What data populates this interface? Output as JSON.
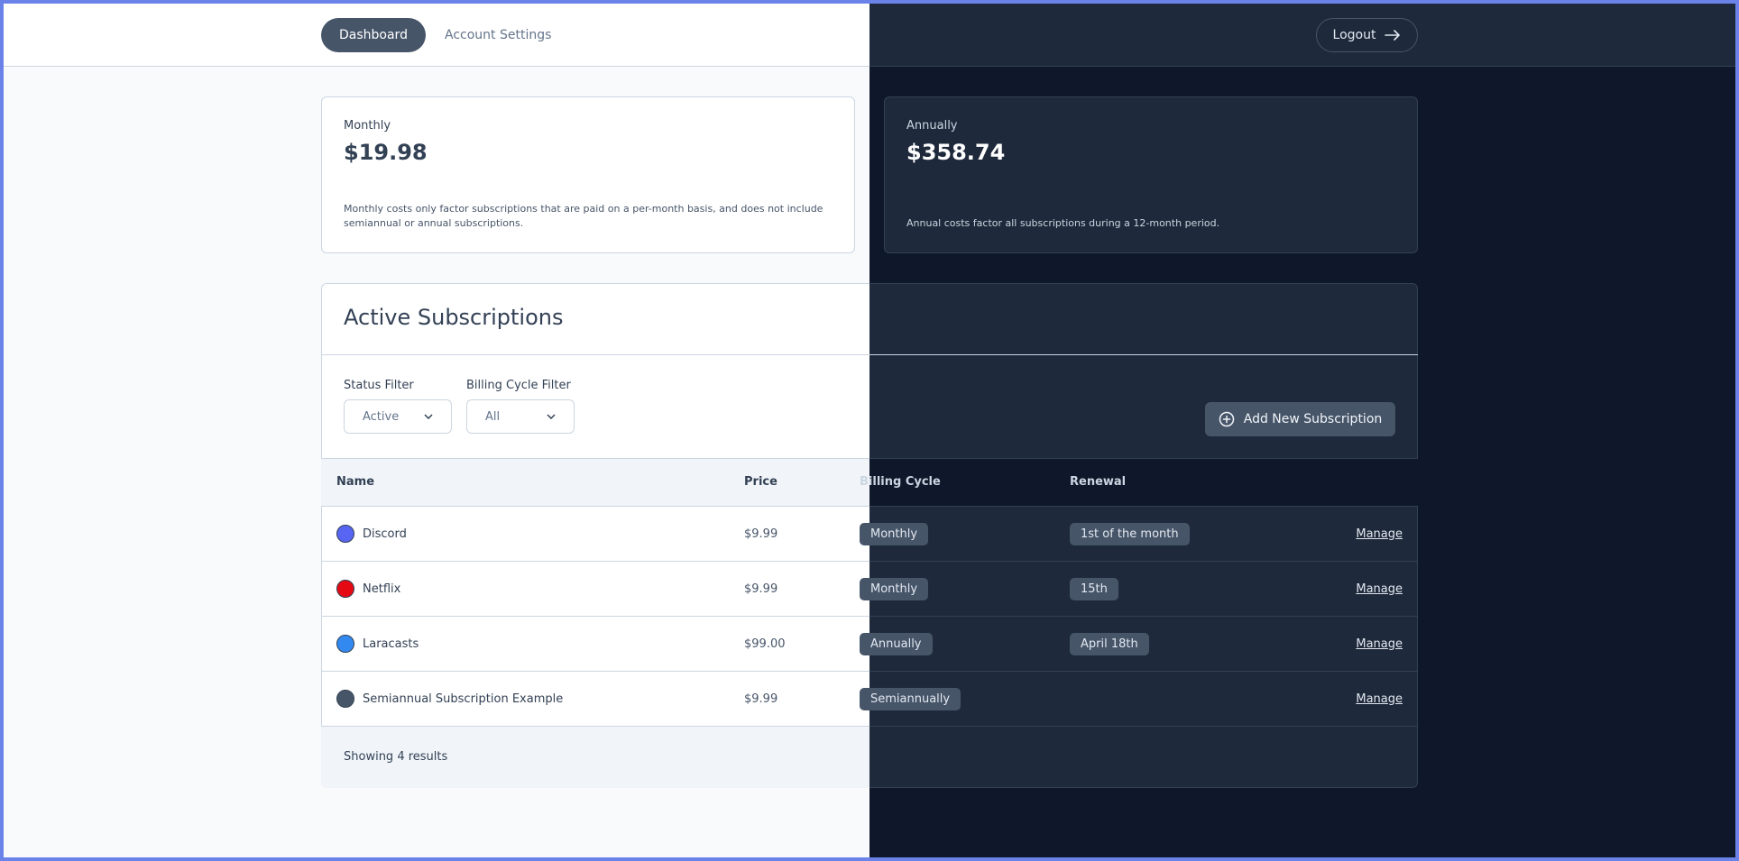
{
  "nav": {
    "dashboard_label": "Dashboard",
    "account_settings_label": "Account Settings",
    "logout_label": "Logout",
    "logout_icon": "arrow-right-icon"
  },
  "summary": {
    "monthly": {
      "label": "Monthly",
      "amount": "$19.98",
      "description": "Monthly costs only factor subscriptions that are paid on a per-month basis, and does not include semiannual or annual subscriptions."
    },
    "annually": {
      "label": "Annually",
      "amount": "$358.74",
      "description": "Annual costs factor all subscriptions during a 12-month period."
    }
  },
  "subscriptions": {
    "title": "Active Subscriptions",
    "status_filter": {
      "label": "Status Filter",
      "value": "Active"
    },
    "billing_filter": {
      "label": "Billing Cycle Filter",
      "value": "All"
    },
    "add_button_label": "Add New Subscription",
    "columns": {
      "name": "Name",
      "price": "Price",
      "billing_cycle": "Billing Cycle",
      "renewal": "Renewal"
    },
    "rows": [
      {
        "name": "Discord",
        "price": "$9.99",
        "billing_cycle": "Monthly",
        "renewal": "1st of the month",
        "action": "Manage",
        "color": "#5865f2"
      },
      {
        "name": "Netflix",
        "price": "$9.99",
        "billing_cycle": "Monthly",
        "renewal": "15th",
        "action": "Manage",
        "color": "#e50914"
      },
      {
        "name": "Laracasts",
        "price": "$99.00",
        "billing_cycle": "Annually",
        "renewal": "April 18th",
        "action": "Manage",
        "color": "#328af1"
      },
      {
        "name": "Semiannual Subscription Example",
        "price": "$9.99",
        "billing_cycle": "Semiannually",
        "renewal": "",
        "action": "Manage",
        "color": "#475569"
      }
    ],
    "footer": "Showing 4 results"
  },
  "colors": {
    "frame": "#6b82e8",
    "light_bg": "#f8fafc",
    "dark_bg": "#0f172a",
    "dark_surface": "#1e293b",
    "accent": "#475569"
  }
}
